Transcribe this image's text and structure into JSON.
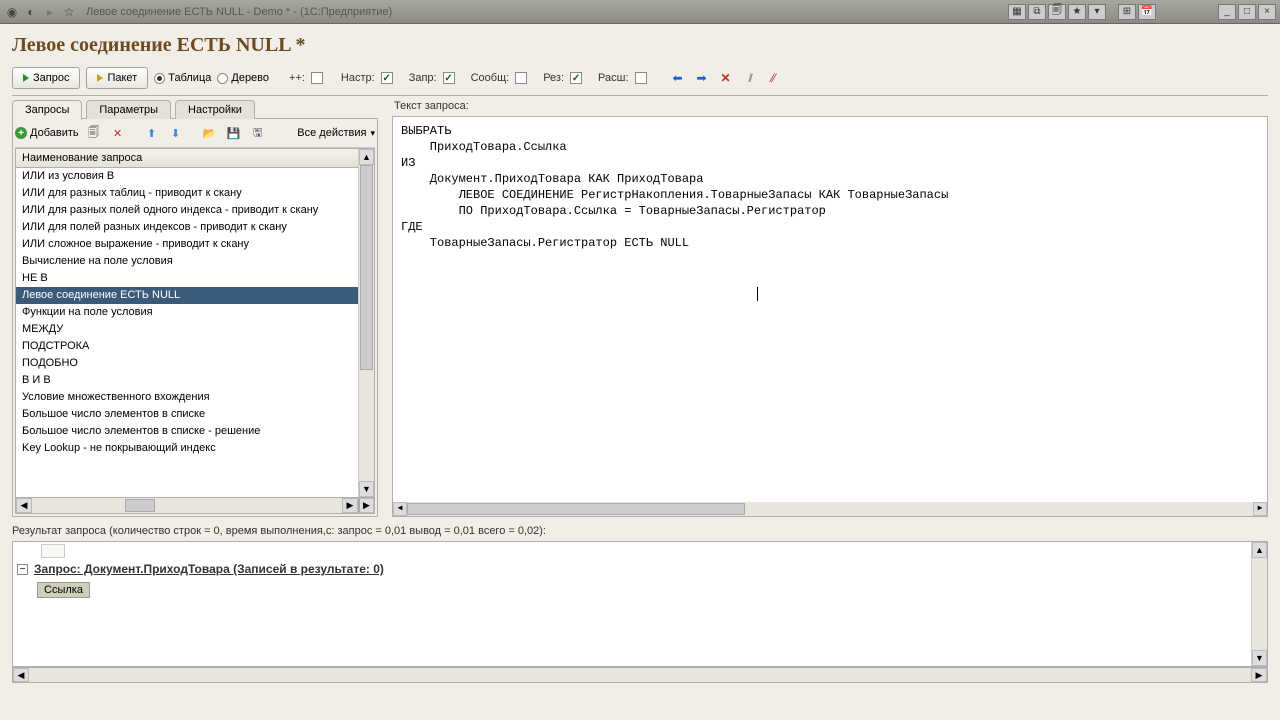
{
  "titlebar": {
    "text": "Левое соединение ЕСТЬ NULL - Demo * - (1С:Предприятие)"
  },
  "page_title": "Левое соединение ЕСТЬ NULL *",
  "toolbar": {
    "btn_query": "Запрос",
    "btn_batch": "Пакет",
    "radio_table": "Таблица",
    "radio_tree": "Дерево",
    "plusplus": "++:",
    "nastr": "Настр:",
    "zapr": "Запр:",
    "soob": "Сообщ:",
    "rez": "Рез:",
    "rash": "Расш:"
  },
  "tabs": {
    "queries": "Запросы",
    "params": "Параметры",
    "settings": "Настройки"
  },
  "list_toolbar": {
    "add": "Добавить",
    "all_actions": "Все действия"
  },
  "list_header": "Наименование запроса",
  "queries": [
    "ИЛИ из условия В",
    "ИЛИ для разных таблиц - приводит к скану",
    "ИЛИ для разных полей одного индекса - приводит к скану",
    "ИЛИ для полей разных индексов - приводит к скану",
    "ИЛИ сложное выражение - приводит к скану",
    "Вычисление на поле условия",
    "НЕ В",
    "Левое соединение ЕСТЬ NULL",
    "Функции на поле условия",
    "МЕЖДУ",
    "ПОДСТРОКА",
    "ПОДОБНО",
    "В И В",
    "Условие множественного вхождения",
    "Большое число элементов в списке",
    "Большое число элементов в списке - решение",
    "Key Lookup - не покрывающий индекс"
  ],
  "selected_index": 7,
  "editor_label": "Текст запроса:",
  "query_text": "ВЫБРАТЬ\n    ПриходТовара.Ссылка\nИЗ\n    Документ.ПриходТовара КАК ПриходТовара\n        ЛЕВОЕ СОЕДИНЕНИЕ РегистрНакопления.ТоварныеЗапасы КАК ТоварныеЗапасы\n        ПО ПриходТовара.Ссылка = ТоварныеЗапасы.Регистратор\nГДЕ\n    ТоварныеЗапасы.Регистратор ЕСТЬ NULL",
  "result_label": "Результат запроса (количество строк = 0, время выполнения,с: запрос = 0,01  вывод = 0,01  всего = 0,02):",
  "result_heading": "Запрос: Документ.ПриходТовара (Записей в результате: 0)",
  "result_col": "Ссылка"
}
